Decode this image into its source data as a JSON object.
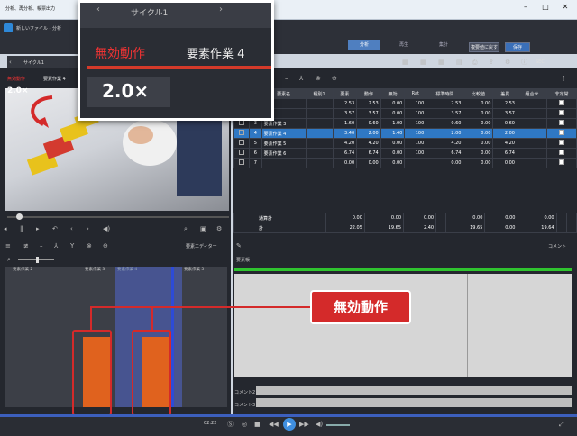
{
  "window": {
    "title": "分析、再分析、帳票出力"
  },
  "app": {
    "file_label": "新しいファイル - 分析",
    "cycle_label": "サイクル1",
    "tabs": [
      "分析",
      "再生",
      "集計"
    ],
    "btn_compare": "複要値に戻す",
    "btn_save": "保存",
    "unit": "SEC"
  },
  "zoom": {
    "cycle_label": "サイクル1",
    "invalid_label": "無効動作",
    "element_label": "要素作業 4",
    "speed": "2.0×"
  },
  "video": {
    "invalid_label": "無効動作",
    "element_label": "要素作業 4",
    "speed": "2.0×"
  },
  "table": {
    "headers": [
      "",
      "",
      "要素名",
      "種別1",
      "要素",
      "動作",
      "無効",
      "Rat",
      "標準時間",
      "比較値",
      "差異",
      "組合せ",
      "非定常"
    ],
    "rows": [
      {
        "n": "1",
        "name": "",
        "v": [
          "2.53",
          "2.53",
          "0.00",
          "100",
          "2.53",
          "0.00",
          "2.53"
        ]
      },
      {
        "n": "2",
        "name": "",
        "v": [
          "3.57",
          "3.57",
          "0.00",
          "100",
          "3.57",
          "0.00",
          "3.57"
        ]
      },
      {
        "n": "3",
        "name": "要素作業 3",
        "v": [
          "1.60",
          "0.60",
          "1.00",
          "100",
          "0.60",
          "0.00",
          "0.60"
        ]
      },
      {
        "n": "4",
        "name": "要素作業 4",
        "v": [
          "3.40",
          "2.00",
          "1.40",
          "100",
          "2.00",
          "0.00",
          "2.00"
        ]
      },
      {
        "n": "5",
        "name": "要素作業 5",
        "v": [
          "4.20",
          "4.20",
          "0.00",
          "100",
          "4.20",
          "0.00",
          "4.20"
        ]
      },
      {
        "n": "6",
        "name": "要素作業 6",
        "v": [
          "6.74",
          "6.74",
          "0.00",
          "100",
          "6.74",
          "0.00",
          "6.74"
        ]
      },
      {
        "n": "7",
        "name": "",
        "v": [
          "0.00",
          "0.00",
          "0.00",
          "",
          "0.00",
          "0.00",
          "0.00"
        ]
      }
    ],
    "subtotal_label": "通算計",
    "subtotal": [
      "0.00",
      "0.00",
      "0.00",
      "",
      "0.00",
      "0.00",
      "0.00"
    ],
    "total_label": "計",
    "total": [
      "22.05",
      "19.65",
      "2.40",
      "",
      "19.65",
      "0.00",
      "19.64"
    ]
  },
  "timeline": {
    "header_label": "要素エディター",
    "lanes": [
      "要素作業 2",
      "要素作業 3",
      "要素作業 4",
      "要素作業 5"
    ]
  },
  "right_panel": {
    "comment_header": "コメント",
    "tool_label": "要素帳",
    "comment2": "コメント2",
    "comment3": "コメント3"
  },
  "callout": {
    "label": "無効動作"
  },
  "player": {
    "time": "02:22"
  }
}
